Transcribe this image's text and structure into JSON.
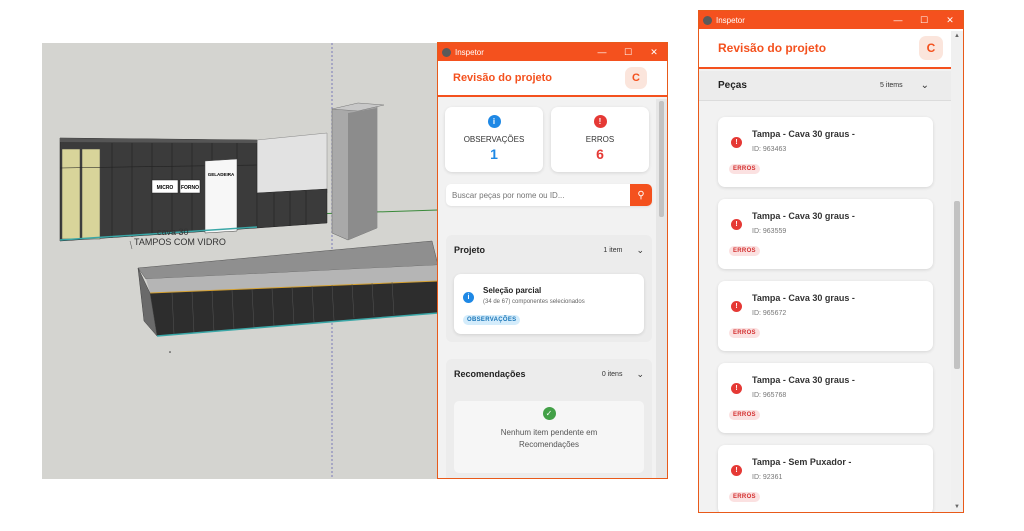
{
  "viewport": {
    "labels": {
      "micro": "MICRO",
      "forno": "FORNO",
      "geladeira": "GELADEIRA",
      "cava": "cava 30",
      "tampos": "TAMPOS COM VIDRO"
    }
  },
  "window1": {
    "titlebar": {
      "title": "Inspetor",
      "minimize": "—",
      "maximize": "☐",
      "close": "✕"
    },
    "header": {
      "title": "Revisão do projeto",
      "refresh_icon": "C"
    },
    "stats": [
      {
        "icon": "i",
        "label": "OBSERVAÇÕES",
        "value": "1",
        "color": "#1e88e5"
      },
      {
        "icon": "!",
        "label": "ERROS",
        "value": "6",
        "color": "#e53935"
      }
    ],
    "search": {
      "placeholder": "Buscar peças por nome ou ID...",
      "button_icon": "⚲"
    },
    "projeto": {
      "name": "Projeto",
      "count": "1 item",
      "chevron": "⌄",
      "card": {
        "icon": "i",
        "title": "Seleção parcial",
        "subtitle": "(34 de 67) componentes selecionados",
        "badge": "OBSERVAÇÕES"
      }
    },
    "recomendacoes": {
      "name": "Recomendações",
      "count": "0 itens",
      "chevron": "⌄",
      "empty_icon": "✓",
      "empty_text_1": "Nenhum item pendente em",
      "empty_text_2": "Recomendações"
    }
  },
  "window2": {
    "titlebar": {
      "title": "Inspetor",
      "minimize": "—",
      "maximize": "☐",
      "close": "✕"
    },
    "header": {
      "title": "Revisão do projeto",
      "refresh_icon": "C"
    },
    "pecas": {
      "name": "Peças",
      "count": "5 items",
      "chevron": "⌄"
    },
    "items": [
      {
        "title": "Tampa - Cava 30 graus -",
        "id": "ID: 963463",
        "badge": "ERROS"
      },
      {
        "title": "Tampa - Cava 30 graus -",
        "id": "ID: 963559",
        "badge": "ERROS"
      },
      {
        "title": "Tampa - Cava 30 graus -",
        "id": "ID: 965672",
        "badge": "ERROS"
      },
      {
        "title": "Tampa - Cava 30 graus -",
        "id": "ID: 965768",
        "badge": "ERROS"
      },
      {
        "title": "Tampa - Sem Puxador -",
        "id": "ID: 92361",
        "badge": "ERROS"
      }
    ]
  },
  "colors": {
    "accent": "#f4511e",
    "info": "#1e88e5",
    "error": "#e53935",
    "success": "#43a047"
  }
}
